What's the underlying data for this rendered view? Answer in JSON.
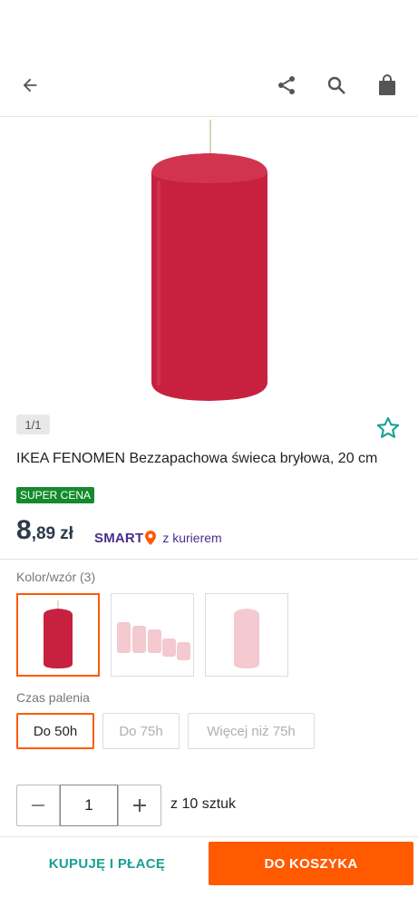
{
  "gallery": {
    "pager": "1/1"
  },
  "product": {
    "title": "IKEA FENOMEN Bezzapachowa świeca bryłowa, 20 cm",
    "badge": "SUPER CENA",
    "price_int": "8",
    "price_dec": ",89",
    "currency": "zł",
    "smart_label": "SMART",
    "delivery_text": "z kurierem"
  },
  "variants": {
    "color_label": "Kolor/wzór (3)",
    "burn_label": "Czas palenia",
    "burn_options": [
      "Do 50h",
      "Do 75h",
      "Więcej niż 75h"
    ]
  },
  "quantity": {
    "value": "1",
    "note": "z 10 sztuk"
  },
  "actions": {
    "buy_now": "KUPUJĘ I PŁACĘ",
    "add_to_cart": "DO KOSZYKA"
  },
  "colors": {
    "accent": "#ff5a00",
    "teal": "#17a095",
    "badge_green": "#138a2c",
    "smart_purple": "#4a2e8a",
    "candle_red": "#c8203f"
  }
}
